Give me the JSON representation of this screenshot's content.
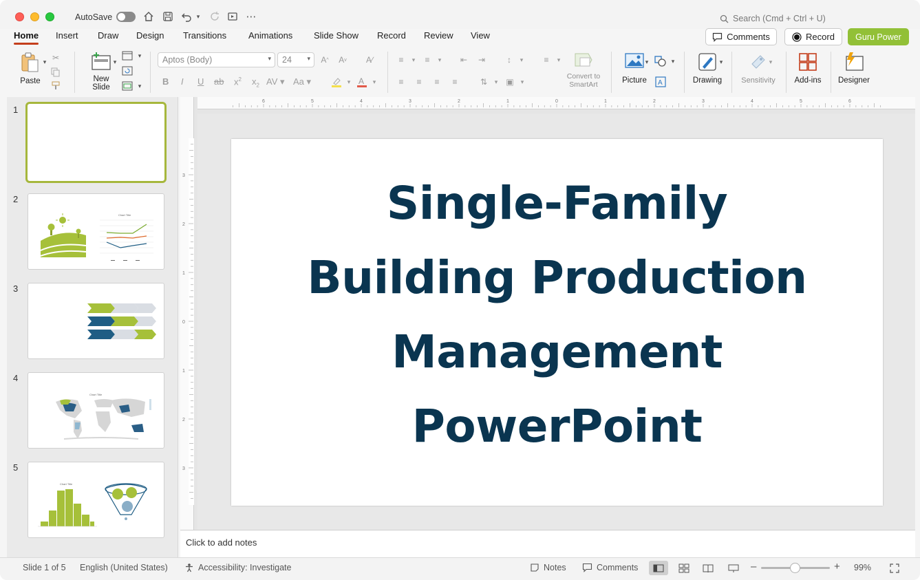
{
  "app": {
    "autosave_label": "AutoSave",
    "search_placeholder": "Search (Cmd + Ctrl + U)"
  },
  "tabs": [
    "Home",
    "Insert",
    "Draw",
    "Design",
    "Transitions",
    "Animations",
    "Slide Show",
    "Record",
    "Review",
    "View"
  ],
  "header_buttons": {
    "comments": "Comments",
    "record": "Record",
    "addin": "Guru Power"
  },
  "ribbon": {
    "paste": "Paste",
    "new_slide": [
      "New",
      "Slide"
    ],
    "font_name": "Aptos (Body)",
    "font_size": "24",
    "convert_smartart": [
      "Convert to",
      "SmartArt"
    ],
    "picture": "Picture",
    "drawing": "Drawing",
    "sensitivity": "Sensitivity",
    "addins": "Add-ins",
    "designer": "Designer"
  },
  "slides": {
    "numbers": [
      "1",
      "2",
      "3",
      "4",
      "5"
    ],
    "thumb_labels": {
      "chart_title_2": "Chart Title",
      "chart_title_4": "Chart Title",
      "chart_title_5": "Chart Title"
    }
  },
  "slide": {
    "title_lines": [
      "Single-Family",
      "Building Production",
      "Management",
      "PowerPoint"
    ],
    "title_color": "#0a3550"
  },
  "notes": {
    "placeholder": "Click to add notes"
  },
  "status": {
    "slide_info": "Slide 1 of 5",
    "language": "English (United States)",
    "accessibility": "Accessibility: Investigate",
    "notes": "Notes",
    "comments": "Comments",
    "zoom": "99%"
  },
  "ruler": {
    "h_labels": [
      "6",
      "5",
      "4",
      "3",
      "2",
      "1",
      "0",
      "1",
      "2",
      "3",
      "4",
      "5",
      "6"
    ],
    "v_labels": [
      "3",
      "2",
      "1",
      "0",
      "1",
      "2",
      "3"
    ]
  },
  "colors": {
    "accent": "#c43e1c",
    "brand_green": "#92c037",
    "slide_navy": "#0a3550",
    "thumb_green": "#a6c03a",
    "thumb_blue": "#1f5d84"
  }
}
